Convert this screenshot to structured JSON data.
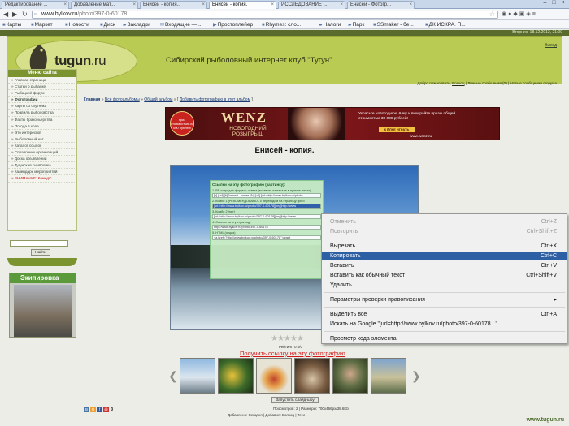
{
  "browser": {
    "tabs": [
      {
        "label": "Редактирование ..."
      },
      {
        "label": "Добавление мат..."
      },
      {
        "label": "Енисей - копия..."
      },
      {
        "label": "Енисей - копия."
      },
      {
        "label": "ИССЛЕДОВАНИЕ ..."
      },
      {
        "label": "Енисей - Фотогр..."
      }
    ],
    "url_host": "www.bylkov.ru",
    "url_path": "/photo/397-0-60178",
    "bookmarks": [
      "Карты",
      "Маркет",
      "Новости",
      "Диск",
      "Закладки",
      "Входящие — ...",
      "Простоплейер",
      "Rhymes: сло...",
      "Налоги",
      "Парк",
      "SSmaker - бе...",
      "ДК ИСКРА. П..."
    ]
  },
  "site": {
    "date_line": "Вторник, 18.12.2012, 21:00",
    "logo_text": "tugun",
    "logo_suffix": ".ru",
    "title": "Сибирский рыболовный интернет клуб \"Тугун\"",
    "register_link": "Выход",
    "welcome": {
      "prefix": "Добро пожаловать,",
      "user": "Волкоц",
      "links": "| Личные сообщения (0) | Новые сообщения форума"
    }
  },
  "menu": {
    "title": "Меню сайта",
    "items": [
      {
        "label": "Главная страница"
      },
      {
        "label": "Статьи о рыбалке"
      },
      {
        "label": "Рыбацкий форум"
      },
      {
        "label": "Фотографии"
      },
      {
        "label": "Карты со спутника"
      },
      {
        "label": "Правила рыболовства"
      },
      {
        "label": "Факты браконьерства"
      },
      {
        "label": "Погода в крае"
      },
      {
        "label": "Это интересно!"
      },
      {
        "label": "Рыболовный чат"
      },
      {
        "label": "Каталог ссылок"
      },
      {
        "label": "Справочник организаций"
      },
      {
        "label": "Доска объявлений"
      },
      {
        "label": "Тугунская символика"
      },
      {
        "label": "Календарь мероприятий"
      },
      {
        "label": "ВНИМАНИЕ: Конкурс"
      }
    ],
    "search_button": "Найти",
    "equip_title": "Экипировка"
  },
  "content": {
    "breadcrumbs": {
      "home": "Главная",
      "albums": "Все фотоальбомы",
      "album": "Общий альбом",
      "add": "Добавить фотографию в этот альбом"
    },
    "banner": {
      "brand": "WENZ",
      "sub": "НОВОГОДНИЙ РОЗЫГРЫШ",
      "badge": "приз стоимостью 30 000 рублей!",
      "right_text": "Украсьте новогоднюю ёлку и выиграйте призы общей стоимостью 30 000 рублей!",
      "button": "К ЁЛКЕ ИГРАТЬ",
      "url": "www.wenz.ru"
    },
    "photo_title": "Енисей - копия.",
    "link_box": {
      "title": "Ссылки на эту фотографию (картинку):",
      "fields": [
        {
          "label": "1. BB-коды для форума: ответа (вставить из начале в нужное место)",
          "value": "[b] [url] [b]Енисей - копия.[/b] [url] [url=http://www.bylkov.ru/photo"
        },
        {
          "label": "2. Комбо 1 (РЕКОМЕНДОВАНО - с переходом на страницу фото",
          "value": "[url=http://www.bylkov.ru/photo/397-0-60178][img]http://www"
        },
        {
          "label": "3. Комбо 2 (нет)",
          "value": "[url=http://www.bylkov.ru/photo/397-0-60178][img]http://www"
        },
        {
          "label": "4. Ссылка на эту страницу:",
          "value": "http://www.bylkov.ru/photo/397-0-60178"
        },
        {
          "label": "5. HTML (опция)",
          "value": "<a href=\"http://www.bylkov.ru/photo/397-0-60178\" target"
        }
      ]
    },
    "rating": "Рейтинг: 0.0/0",
    "get_link": "Получить ссылку на эту фотографию",
    "slideshow": "Запустить слайд-шоу",
    "stats": "Просмотров: 2 | Размеры: 700x466px/38.6Kb",
    "added": "Добавлено: Сегодня | Добавил: Волкоц | Теги",
    "watermark": "www.tugun.ru",
    "share_count": "0"
  },
  "context_menu": {
    "items": [
      {
        "label": "Отменить",
        "shortcut": "Ctrl+Z",
        "disabled": true
      },
      {
        "label": "Повторить",
        "shortcut": "Ctrl+Shift+Z",
        "disabled": true
      },
      {
        "label": "Вырезать",
        "shortcut": "Ctrl+X"
      },
      {
        "label": "Копировать",
        "shortcut": "Ctrl+C",
        "highlighted": true
      },
      {
        "label": "Вставить",
        "shortcut": "Ctrl+V"
      },
      {
        "label": "Вставить как обычный текст",
        "shortcut": "Ctrl+Shift+V"
      },
      {
        "label": "Удалить",
        "shortcut": ""
      },
      {
        "label": "Параметры проверки правописания",
        "shortcut": "▸"
      },
      {
        "label": "Выделить все",
        "shortcut": "Ctrl+A"
      },
      {
        "label": "Искать на Google \"[url=http://www.bylkov.ru/photo/397-0-60178...\"",
        "shortcut": ""
      },
      {
        "label": "Просмотр кода элемента",
        "shortcut": ""
      }
    ]
  },
  "colors": {
    "header_green": "#b9cb53",
    "menu_green": "#7c9430",
    "highlight_blue": "#2d5fa5",
    "link_red": "#d21a1a"
  }
}
